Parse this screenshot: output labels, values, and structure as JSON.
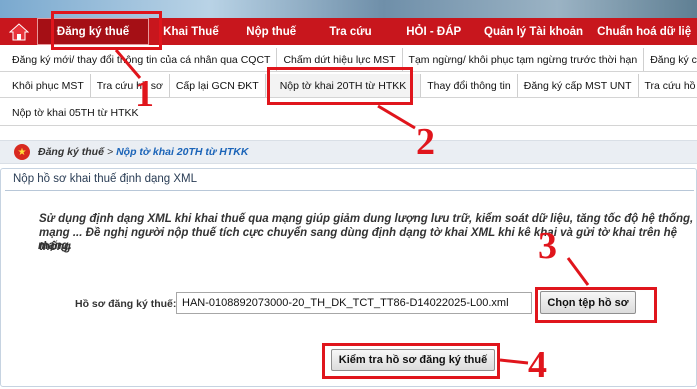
{
  "mainnav": {
    "items": [
      "Đăng ký thuế",
      "Khai Thuế",
      "Nộp thuế",
      "Tra cứu",
      "HỎI - ĐÁP",
      "Quản lý Tài khoản",
      "Chuẩn hoá dữ liệ"
    ]
  },
  "subnav": {
    "row1": [
      "Đăng ký mới/ thay đổi thông tin của cá nhân qua CQCT",
      "Chấm dứt hiệu lực MST",
      "Tạm ngừng/ khôi phục tạm ngừng trước thời hạn",
      "Đăng ký cấ"
    ],
    "row2": [
      "Khôi phục MST",
      "Tra cứu hồ sơ",
      "Cấp lại GCN ĐKT",
      "Nộp tờ khai 20TH từ HTKK",
      "Thay đổi thông tin",
      "Đăng ký cấp MST UNT",
      "Tra cứu hồ s"
    ],
    "row3": [
      "Nộp tờ khai 05TH từ HTKK"
    ]
  },
  "breadcrumb": {
    "section": "Đăng ký thuế",
    "separator": ">",
    "current": "Nộp tờ khai 20TH từ HTKK"
  },
  "panel": {
    "title": "Nộp hồ sơ khai thuế định dạng XML",
    "description": "Sử dụng định dạng XML khi khai thuế qua mạng giúp giảm dung lượng lưu trữ, kiểm soát dữ liệu, tăng tốc độ hệ thống, mạng ... Đề nghị người nộp thuế tích cực chuyển sang dùng định dạng tờ khai XML khi kê khai và gửi tờ khai trên hệ thống",
    "description_end": "mạng."
  },
  "form": {
    "file_label": "Hồ sơ đăng ký thuế:",
    "file_value": "HAN-0108892073000-20_TH_DK_TCT_TT86-D14022025-L00.xml",
    "choose_button": "Chọn tệp hồ sơ",
    "check_button": "Kiểm tra hồ sơ đăng ký thuế"
  },
  "annotations": {
    "n1": "1",
    "n2": "2",
    "n3": "3",
    "n4": "4"
  },
  "colors": {
    "nav_red": "#c8161d",
    "annotation_red": "#e0151c",
    "breadcrumb_blue": "#1b64b8"
  }
}
